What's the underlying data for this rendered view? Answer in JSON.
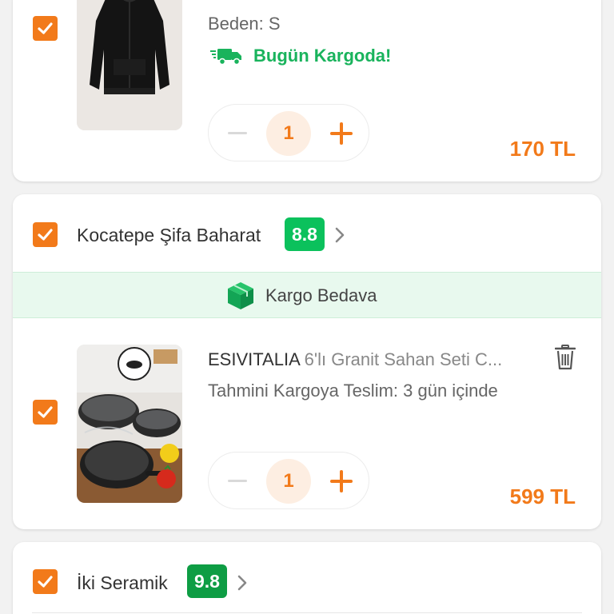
{
  "cart": {
    "item1": {
      "size_label": "Beden: S",
      "delivery_badge": "Bugün Kargoda!",
      "quantity": "1",
      "price": "170 TL",
      "checked": true
    },
    "seller2": {
      "name": "Kocatepe Şifa Baharat",
      "rating": "8.8",
      "shipping_banner": "Kargo Bedava",
      "item": {
        "brand": "ESIVITALIA",
        "title": "6'lı Granit Sahan Seti C...",
        "delivery_estimate": "Tahmini Kargoya Teslim: 3 gün içinde",
        "quantity": "1",
        "price": "599 TL",
        "checked": true
      }
    },
    "seller3": {
      "name": "İki Seramik",
      "rating": "9.8"
    }
  },
  "colors": {
    "accent": "#f27a1a",
    "success": "#0bc15c",
    "delivery_green": "#19b35c",
    "banner_bg": "#e8f9ee"
  },
  "icons": {
    "truck": "truck-icon",
    "box": "package-icon",
    "trash": "trash-icon",
    "chevron": "chevron-right-icon",
    "check": "check-icon"
  }
}
